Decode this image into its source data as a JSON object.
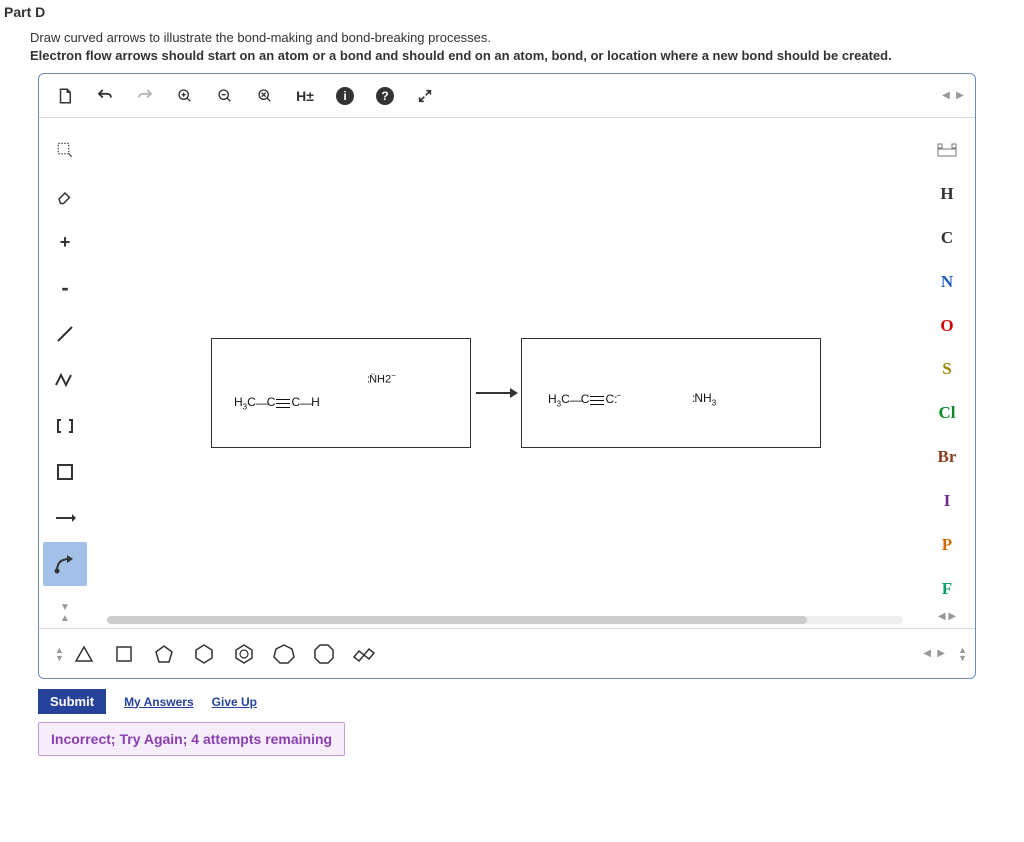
{
  "part_label": "Part D",
  "instr1": "Draw curved arrows to illustrate the bond-making and bond-breaking processes.",
  "instr2": "Electron flow arrows should start on an atom or a bond and should end on an atom, bond, or location where a new bond should be created.",
  "topbar": {
    "hpm": "H±"
  },
  "leftcol": {
    "plus": "+",
    "minus": "-"
  },
  "rightcol": {
    "H": "H",
    "C": "C",
    "N": "N",
    "O": "O",
    "S": "S",
    "Cl": "Cl",
    "Br": "Br",
    "I": "I",
    "P": "P",
    "F": "F"
  },
  "colors": {
    "H": "#333333",
    "C": "#333333",
    "N": "#1f5fbf",
    "O": "#d40000",
    "S": "#9b8600",
    "Cl": "#0a8a2a",
    "Br": "#8a3f1f",
    "I": "#6a2e8a",
    "P": "#d46a00",
    "F": "#0aa06a"
  },
  "reaction": {
    "left_main_html": "H<span class='sub'>3</span>C<span class='bond'>—</span>C<span class='triple'><span class='midl'></span></span>C<span class='bond'>—</span>H",
    "left_nh2_html": "<span class='dots'>:</span>N&#776;H<span class='sub'>2</span><span class='minus-sup'>−</span>",
    "right_main_html": "H<span class='sub'>3</span>C<span class='bond'>—</span>C<span class='triple'><span class='midl'></span></span>C<span class='dots'>:</span><span class='minus-sup'>−</span>",
    "right_nh3_html": "<span class='dots'>:</span>NH<span class='sub'>3</span>",
    "arrow": "→"
  },
  "submit": {
    "submit": "Submit",
    "myanswers": "My Answers",
    "giveup": "Give Up"
  },
  "feedback": "Incorrect; Try Again; 4 attempts remaining"
}
